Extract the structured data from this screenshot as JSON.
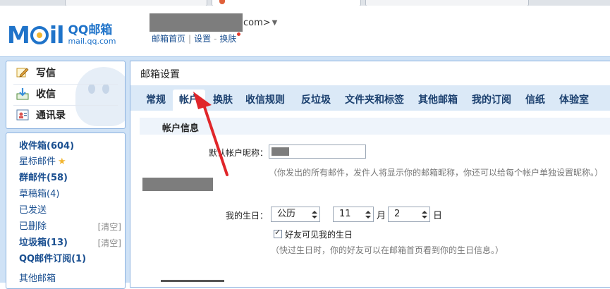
{
  "header": {
    "brand": "QQ邮箱",
    "domain": "mail.qq.com",
    "account_suffix": "com>",
    "links": [
      "邮箱首页",
      "设置",
      "换肤"
    ]
  },
  "left": {
    "quick": [
      "写信",
      "收信",
      "通讯录"
    ],
    "folders": [
      {
        "label": "收件箱(604)",
        "bold": true
      },
      {
        "label": "星标邮件",
        "bold": false
      },
      {
        "label": "群邮件(58)",
        "bold": true
      },
      {
        "label": "草稿箱(4)",
        "bold": false
      },
      {
        "label": "已发送",
        "bold": false
      },
      {
        "label": "已删除",
        "bold": false,
        "action": "[清空]"
      },
      {
        "label": "垃圾箱(13)",
        "bold": true,
        "action": "[清空]"
      },
      {
        "label": "QQ邮件订阅(1)",
        "bold": true
      },
      {
        "label": "其他邮箱",
        "bold": false
      }
    ]
  },
  "main": {
    "title": "邮箱设置",
    "tabs": [
      "常规",
      "帐户",
      "换肤",
      "收信规则",
      "反垃圾",
      "文件夹和标签",
      "其他邮箱",
      "我的订阅",
      "信纸",
      "体验室"
    ],
    "active_tab": "帐户",
    "section_title": "帐户信息",
    "nickname_label": "默认帐户昵称：",
    "nickname_hint": "（你发出的所有邮件，发件人将显示你的邮箱昵称，你还可以给每个帐户单独设置昵称。）",
    "birthday_label": "我的生日：",
    "calendar": "公历",
    "month": "11",
    "month_unit": "月",
    "day": "2",
    "day_unit": "日",
    "birthday_visible_label": "好友可见我的生日",
    "birthday_hint": "（快过生日时，你的好友可以在邮箱首页看到你的生日信息。）"
  },
  "colors": {
    "brand_blue": "#1f73c9",
    "frame_blue": "#cfe2f6",
    "annotation_red": "#e0262a"
  }
}
